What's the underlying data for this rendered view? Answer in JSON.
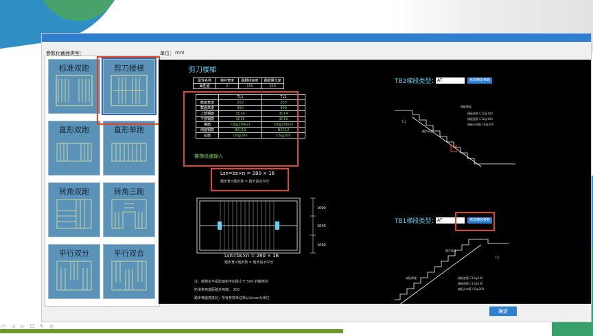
{
  "dialog": {
    "title": "",
    "section_label": "参数化截面类型：",
    "unit_label": "单位：",
    "unit_value": "mm",
    "ok_button": "确定"
  },
  "stair_types": [
    {
      "label": "标准双跑"
    },
    {
      "label": "剪刀楼梯",
      "selected": true
    },
    {
      "label": "直形双跑"
    },
    {
      "label": "直形单跑"
    },
    {
      "label": "转角双跑"
    },
    {
      "label": "转角三跑"
    },
    {
      "label": "平行双分"
    },
    {
      "label": "平行双合"
    }
  ],
  "preview": {
    "title": "剪刀楼梯",
    "table1": {
      "headers": [
        "属性名称",
        "梯井宽度",
        "踢脚线高度",
        "踢脚量长度"
      ],
      "row": [
        "属性值",
        "0",
        "150",
        "200"
      ]
    },
    "table2": {
      "headers": [
        "",
        "TL1",
        "TL2"
      ],
      "rows": [
        [
          "截面宽度",
          "200",
          "200"
        ],
        [
          "截面高度",
          "400",
          "400"
        ],
        [
          "上部钢筋",
          "3C14",
          "3C14"
        ],
        [
          "下部钢筋",
          "3C16",
          "3C16"
        ],
        [
          "箍筋",
          "C8@200(2)",
          "C8@200(2)"
        ],
        [
          "侧面钢筋",
          "N2C12",
          "N2C12"
        ],
        [
          "拉筋",
          "C6@200",
          "C6@200"
        ]
      ]
    },
    "link": "楼梯快速输入",
    "formula_top": "Lsn=bs×n = 280 × 16",
    "formula_top_sub": "踏步宽×踏步数 = 踏步段水平长",
    "formula_bottom": "Lsn=bs×n = 280 × 16",
    "formula_bottom_sub": "踏步宽×踏步数 = 踏步段水平长",
    "notes": [
      "注：楼梯水平投影面积不扣除小于 500 的楼梯井",
      "防滑条两端距踏步两端： 200",
      "踏步梯面高度处，所有参数单位默认以mm为单位"
    ],
    "tb2": {
      "label": "TB2梯段类型：",
      "value": "AT",
      "button": "修改梯段参数"
    },
    "tb1": {
      "label": "TB1梯段类型：",
      "value": "AT",
      "button": "修改梯段参数"
    },
    "tb2_annotations": [
      "梯板厚度",
      "踏步高度",
      "梯板底筋 C12@100",
      "梯板面筋 C12@100",
      "梯板分布筋 C8@200",
      "TL2"
    ],
    "tb1_annotations": [
      "踏步高度",
      "梯板底筋 C12@100",
      "梯板面筋 C12@100",
      "梯板分布筋 C8@200",
      "梯板厚度",
      "TL1"
    ],
    "plan_dims": [
      "1090",
      "1040",
      "1090"
    ]
  },
  "colors": {
    "accent": "#2f7fd0",
    "highlight": "#e0452a",
    "thumb_bg": "#5a92b8",
    "preview_bg": "#000000",
    "title_cyan": "#5fd3f5",
    "rebar_green": "#7ed957"
  }
}
